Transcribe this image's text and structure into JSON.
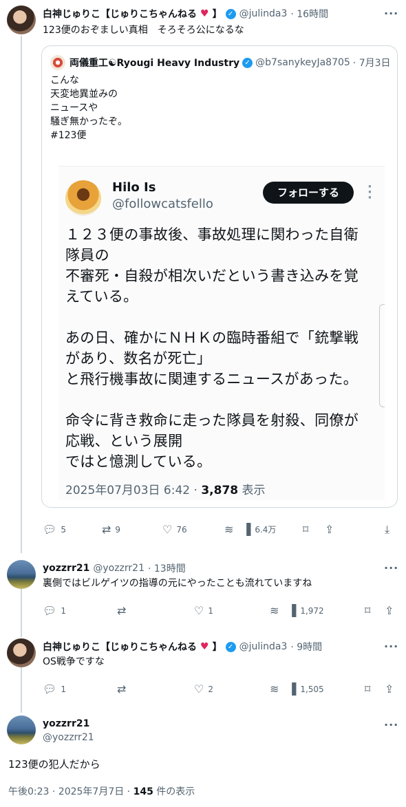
{
  "tweet1": {
    "name": "白神じゅりこ【じゅりこちゃんねる",
    "name_tail": "】",
    "handle": "@julinda3",
    "time": "· 16時間",
    "text": "123便のおぞましい真相　そろそろ公になるな",
    "quote": {
      "name": "両儀重工☯Ryougi Heavy Industry",
      "handle": "@b7sanykeyJa8705",
      "time": "· 7月3日",
      "text": "こんな\n天変地異並みの\nニュースや\n騒ぎ無かったぞ。\n#123便",
      "embed": {
        "name": "Hilo Is",
        "handle": "@followcatsfello",
        "follow_label": "フォローする",
        "text": "１２３便の事故後、事故処理に関わった自衛\n隊員の\n不審死・自殺が相次いだという書き込みを覚\nえている。\n\nあの日、確かにＮＨＫの臨時番組で「銃撃戦\nがあり、数名が死亡」\nと飛行機事故に関連するニュースがあった。\n\n命令に背き救命に走った隊員を射殺、同僚が\n応戦、という展開\nではと憶測している。",
        "date": "2025年07月03日 6:42 · ",
        "views": "3,878",
        "views_label": " 表示"
      }
    },
    "actions": {
      "replies": "5",
      "retweets": "9",
      "likes": "76",
      "views": "6.4万"
    }
  },
  "tweet2": {
    "name": "yozzrr21",
    "handle": "@yozzrr21",
    "time": "· 13時間",
    "text": "裏側ではビルゲイツの指導の元にやったことも流れていますね",
    "actions": {
      "replies": "1",
      "retweets": "",
      "likes": "1",
      "views": "1,972"
    }
  },
  "tweet3": {
    "name": "白神じゅりこ【じゅりこちゃんねる",
    "name_tail": "】",
    "handle": "@julinda3",
    "time": "· 9時間",
    "text": "OS戦争ですな",
    "actions": {
      "replies": "1",
      "retweets": "",
      "likes": "2",
      "views": "1,505"
    }
  },
  "main": {
    "name": "yozzrr21",
    "handle": "@yozzrr21",
    "text": "123便の犯人だから",
    "meta_prefix": "午後0:23 · 2025年7月7日 · ",
    "views": "145",
    "views_label": " 件の表示"
  },
  "icons": {
    "reply": "reply-icon",
    "retweet": "retweet-icon",
    "like": "heart-icon",
    "grok": "grok-icon",
    "views": "views-bar-icon",
    "bookmark": "bookmark-icon",
    "share": "share-icon",
    "download": "download-icon",
    "more": "more-icon",
    "verified": "verified-badge-icon"
  },
  "colors": {
    "accent": "#1d9bf0",
    "heart": "#e0245e",
    "muted": "#536471",
    "text": "#0f1419"
  }
}
